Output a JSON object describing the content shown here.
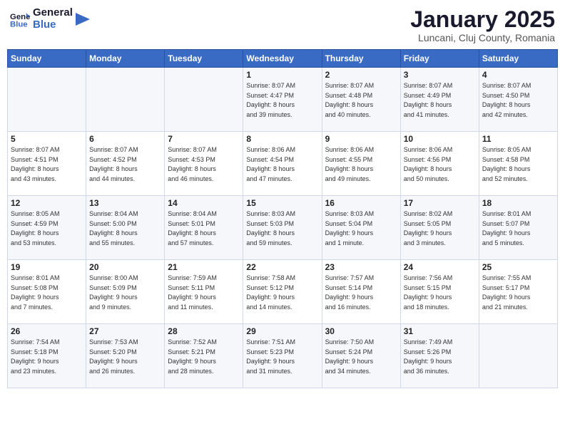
{
  "header": {
    "logo_general": "General",
    "logo_blue": "Blue",
    "title": "January 2025",
    "subtitle": "Luncani, Cluj County, Romania"
  },
  "weekdays": [
    "Sunday",
    "Monday",
    "Tuesday",
    "Wednesday",
    "Thursday",
    "Friday",
    "Saturday"
  ],
  "weeks": [
    [
      {
        "day": "",
        "info": ""
      },
      {
        "day": "",
        "info": ""
      },
      {
        "day": "",
        "info": ""
      },
      {
        "day": "1",
        "info": "Sunrise: 8:07 AM\nSunset: 4:47 PM\nDaylight: 8 hours\nand 39 minutes."
      },
      {
        "day": "2",
        "info": "Sunrise: 8:07 AM\nSunset: 4:48 PM\nDaylight: 8 hours\nand 40 minutes."
      },
      {
        "day": "3",
        "info": "Sunrise: 8:07 AM\nSunset: 4:49 PM\nDaylight: 8 hours\nand 41 minutes."
      },
      {
        "day": "4",
        "info": "Sunrise: 8:07 AM\nSunset: 4:50 PM\nDaylight: 8 hours\nand 42 minutes."
      }
    ],
    [
      {
        "day": "5",
        "info": "Sunrise: 8:07 AM\nSunset: 4:51 PM\nDaylight: 8 hours\nand 43 minutes."
      },
      {
        "day": "6",
        "info": "Sunrise: 8:07 AM\nSunset: 4:52 PM\nDaylight: 8 hours\nand 44 minutes."
      },
      {
        "day": "7",
        "info": "Sunrise: 8:07 AM\nSunset: 4:53 PM\nDaylight: 8 hours\nand 46 minutes."
      },
      {
        "day": "8",
        "info": "Sunrise: 8:06 AM\nSunset: 4:54 PM\nDaylight: 8 hours\nand 47 minutes."
      },
      {
        "day": "9",
        "info": "Sunrise: 8:06 AM\nSunset: 4:55 PM\nDaylight: 8 hours\nand 49 minutes."
      },
      {
        "day": "10",
        "info": "Sunrise: 8:06 AM\nSunset: 4:56 PM\nDaylight: 8 hours\nand 50 minutes."
      },
      {
        "day": "11",
        "info": "Sunrise: 8:05 AM\nSunset: 4:58 PM\nDaylight: 8 hours\nand 52 minutes."
      }
    ],
    [
      {
        "day": "12",
        "info": "Sunrise: 8:05 AM\nSunset: 4:59 PM\nDaylight: 8 hours\nand 53 minutes."
      },
      {
        "day": "13",
        "info": "Sunrise: 8:04 AM\nSunset: 5:00 PM\nDaylight: 8 hours\nand 55 minutes."
      },
      {
        "day": "14",
        "info": "Sunrise: 8:04 AM\nSunset: 5:01 PM\nDaylight: 8 hours\nand 57 minutes."
      },
      {
        "day": "15",
        "info": "Sunrise: 8:03 AM\nSunset: 5:03 PM\nDaylight: 8 hours\nand 59 minutes."
      },
      {
        "day": "16",
        "info": "Sunrise: 8:03 AM\nSunset: 5:04 PM\nDaylight: 9 hours\nand 1 minute."
      },
      {
        "day": "17",
        "info": "Sunrise: 8:02 AM\nSunset: 5:05 PM\nDaylight: 9 hours\nand 3 minutes."
      },
      {
        "day": "18",
        "info": "Sunrise: 8:01 AM\nSunset: 5:07 PM\nDaylight: 9 hours\nand 5 minutes."
      }
    ],
    [
      {
        "day": "19",
        "info": "Sunrise: 8:01 AM\nSunset: 5:08 PM\nDaylight: 9 hours\nand 7 minutes."
      },
      {
        "day": "20",
        "info": "Sunrise: 8:00 AM\nSunset: 5:09 PM\nDaylight: 9 hours\nand 9 minutes."
      },
      {
        "day": "21",
        "info": "Sunrise: 7:59 AM\nSunset: 5:11 PM\nDaylight: 9 hours\nand 11 minutes."
      },
      {
        "day": "22",
        "info": "Sunrise: 7:58 AM\nSunset: 5:12 PM\nDaylight: 9 hours\nand 14 minutes."
      },
      {
        "day": "23",
        "info": "Sunrise: 7:57 AM\nSunset: 5:14 PM\nDaylight: 9 hours\nand 16 minutes."
      },
      {
        "day": "24",
        "info": "Sunrise: 7:56 AM\nSunset: 5:15 PM\nDaylight: 9 hours\nand 18 minutes."
      },
      {
        "day": "25",
        "info": "Sunrise: 7:55 AM\nSunset: 5:17 PM\nDaylight: 9 hours\nand 21 minutes."
      }
    ],
    [
      {
        "day": "26",
        "info": "Sunrise: 7:54 AM\nSunset: 5:18 PM\nDaylight: 9 hours\nand 23 minutes."
      },
      {
        "day": "27",
        "info": "Sunrise: 7:53 AM\nSunset: 5:20 PM\nDaylight: 9 hours\nand 26 minutes."
      },
      {
        "day": "28",
        "info": "Sunrise: 7:52 AM\nSunset: 5:21 PM\nDaylight: 9 hours\nand 28 minutes."
      },
      {
        "day": "29",
        "info": "Sunrise: 7:51 AM\nSunset: 5:23 PM\nDaylight: 9 hours\nand 31 minutes."
      },
      {
        "day": "30",
        "info": "Sunrise: 7:50 AM\nSunset: 5:24 PM\nDaylight: 9 hours\nand 34 minutes."
      },
      {
        "day": "31",
        "info": "Sunrise: 7:49 AM\nSunset: 5:26 PM\nDaylight: 9 hours\nand 36 minutes."
      },
      {
        "day": "",
        "info": ""
      }
    ]
  ]
}
